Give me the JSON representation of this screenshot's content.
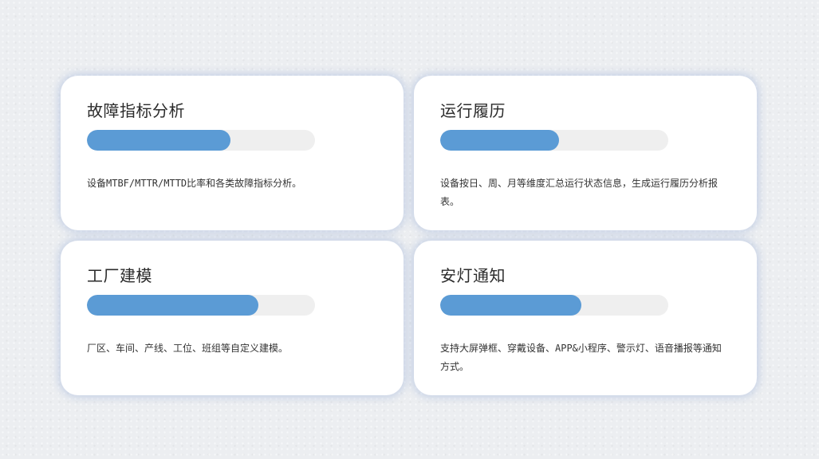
{
  "colors": {
    "background": "#eceef1",
    "card": "#ffffff",
    "accent": "#5b9bd5",
    "track": "#efefef",
    "text": "#333333"
  },
  "cards": [
    {
      "title": "故障指标分析",
      "progress_percent": 63,
      "description": "设备MTBF/MTTR/MTTD比率和各类故障指标分析。"
    },
    {
      "title": "运行履历",
      "progress_percent": 52,
      "description": "设备按日、周、月等维度汇总运行状态信息，生成运行履历分析报表。"
    },
    {
      "title": "工厂建模",
      "progress_percent": 75,
      "description": "厂区、车间、产线、工位、班组等自定义建模。"
    },
    {
      "title": "安灯通知",
      "progress_percent": 62,
      "description": "支持大屏弹框、穿戴设备、APP&小程序、警示灯、语音播报等通知方式。"
    }
  ]
}
